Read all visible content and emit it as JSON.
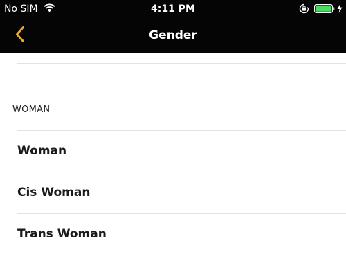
{
  "status_bar": {
    "carrier": "No SIM",
    "time": "4:11 PM",
    "battery_color": "#4cd964"
  },
  "nav": {
    "title": "Gender",
    "accent_color": "#f5a623"
  },
  "section": {
    "header": "WOMAN",
    "items": [
      {
        "label": "Woman"
      },
      {
        "label": "Cis Woman"
      },
      {
        "label": "Trans Woman"
      }
    ]
  }
}
